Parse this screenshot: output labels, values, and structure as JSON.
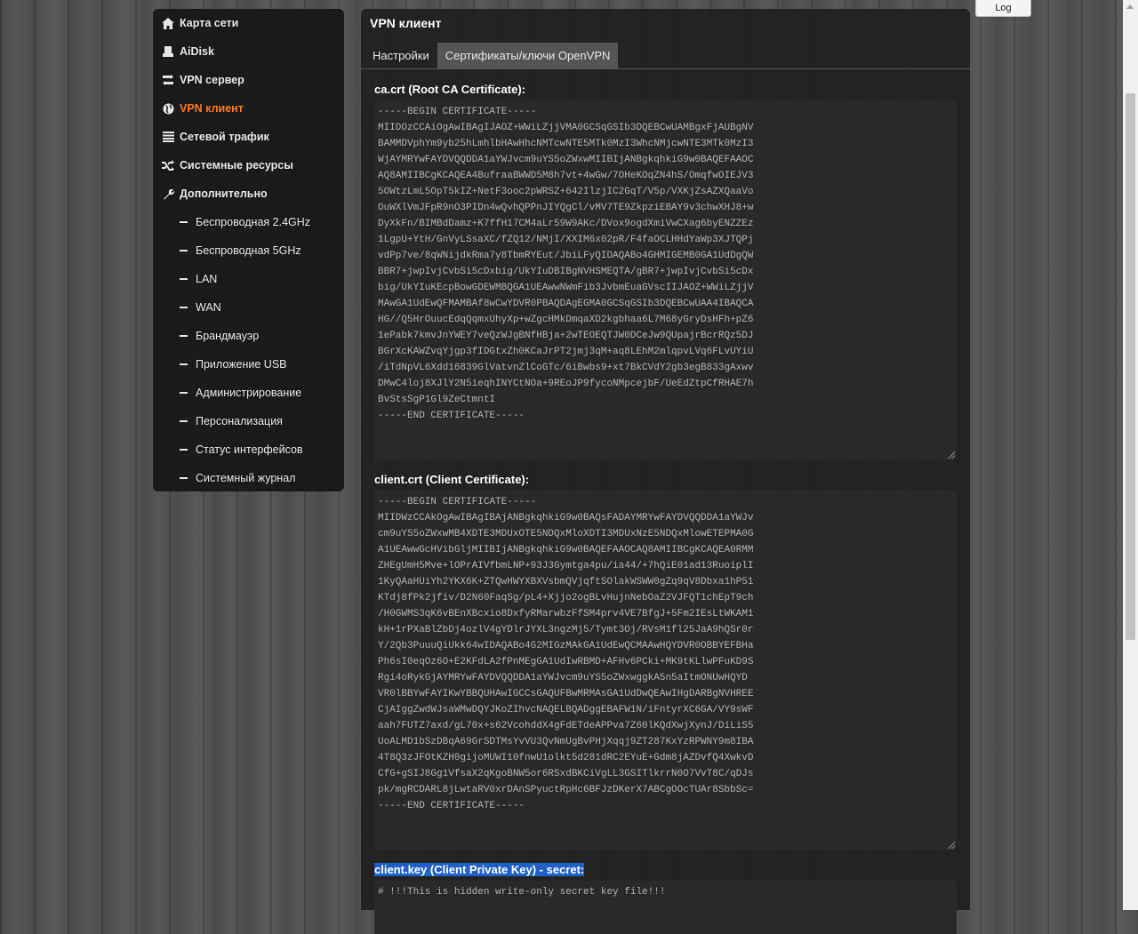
{
  "sidebar": {
    "items": [
      {
        "label": "Карта сети",
        "icon": "home-icon"
      },
      {
        "label": "AiDisk",
        "icon": "disk-icon"
      },
      {
        "label": "VPN сервер",
        "icon": "swap-icon"
      },
      {
        "label": "VPN клиент",
        "icon": "globe-icon",
        "active": true
      },
      {
        "label": "Сетевой трафик",
        "icon": "list-icon"
      },
      {
        "label": "Системные ресурсы",
        "icon": "shuffle-icon"
      },
      {
        "label": "Дополнительно",
        "icon": "wrench-icon"
      }
    ],
    "subitems": [
      "Беспроводная 2.4GHz",
      "Беспроводная 5GHz",
      "LAN",
      "WAN",
      "Брандмауэр",
      "Приложение USB",
      "Администрирование",
      "Персонализация",
      "Статус интерфейсов",
      "Системный журнал"
    ]
  },
  "main": {
    "title": "VPN клиент",
    "tabs": [
      "Настройки",
      "Сертификаты/ключи OpenVPN"
    ],
    "ca_label": "ca.crt (Root CA Certificate):",
    "ca_text": "-----BEGIN CERTIFICATE-----\nMIIDOzCCAiOgAwIBAgIJAOZ+WWiLZjjVMA0GCSqGSIb3DQEBCwUAMBgxFjAUBgNV\nBAMMDVphYm9yb25hLmhlbHAwHhcNMTcwNTE5MTk0MzI3WhcNMjcwNTE3MTk0MzI3\nWjAYMRYwFAYDVQQDDA1aYWJvcm9uYS5oZWxwMIIBIjANBgkqhkiG9w0BAQEFAAOC\nAQ8AMIIBCgKCAQEA4BufraaBWWD5M8h7vt+4wGw/7OHeKOqZN4hS/OmqfwOIEJV3\n5OWtzLmL5OpT5kIZ+NetF3ooc2pWRSZ+642IlzjIC2GqT/V5p/VXKjZsAZXQaaVo\nOuWXlVmJFpR9nO3PIDn4wQvhQPPnJIYQgCl/vMV7TE9ZkpziEBAY9v3chwXHJ8+w\nDyXkFn/BIMBdDamz+K7ffH17CM4aLr59W9AKc/DVox9ogdXmiVwCXag6byENZZEz\n1LgpU+YtH/GnVyLSsaXC/fZQ12/NMjI/XXIM6x02pR/F4faOCLHHdYaWp3XJTQPj\nvdPp7ve/8qWNijdkRma7y8TbmRYEut/JbiLFyQIDAQABo4GHMIGEMB0GA1UdDgQW\nBBR7+jwpIvjCvbSi5cDxbig/UkYIuDBIBgNVHSMEQTA/gBR7+jwpIvjCvbSi5cDx\nbig/UkYIuKEcpBowGDEWMBQGA1UEAwwNWmFib3JvbmEuaGVscIIJAOZ+WWiLZjjV\nMAwGA1UdEwQFMAMBAf8wCwYDVR0PBAQDAgEGMA0GCSqGSIb3DQEBCwUAA4IBAQCA\nHG//Q5HrOuucEdqQqmxUhyXp+wZgcHMkDmqaXD2kgbhaa6L7M68yGryDsHFh+pZ6\n1ePabk7kmvJnYWEY7veQzWJgBNfHBja+2wTEOEQTJW0DCeJw9QUpajrBcrRQz5DJ\nBGrXcKAWZvqYjgp3fIDGtxZh0KCaJrPT2jmj3qM+aq8LEhM2mlqpvLVq6FLvUYiU\n/iTdNpVL6Xdd16839GlVatvnZlCoGTc/6iBwbs9+xt7BkCVdY2gb3egB833gAxwv\nDMwC4loj8XJlY2N5ieqhINYCtNOa+9REoJP9fycoNMpcejbF/UeEdZtpCfRHAE7h\nBvStsSgP1Gl9ZeCtmntI\n-----END CERTIFICATE-----",
    "client_label": "client.crt (Client Certificate):",
    "client_text": "-----BEGIN CERTIFICATE-----\nMIIDWzCCAkOgAwIBAgIBAjANBgkqhkiG9w0BAQsFADAYMRYwFAYDVQQDDA1aYWJv\ncm9uYS5oZWxwMB4XDTE3MDUxOTE5NDQxMloXDTI3MDUxNzE5NDQxMlowETEPMA0G\nA1UEAwwGcHVibGljMIIBIjANBgkqhkiG9w0BAQEFAAOCAQ8AMIIBCgKCAQEA0RMM\nZHEgUmH5Mve+lOPrAIVfbmLNP+93J3Gymtga4pu/ia44/+7hQiE01ad13RuoiplI\n1KyQAaHUiYh2YKX6K+ZTQwHWYXBXVsbmQVjqftSOlakWSWW0gZq9qV8Dbxa1hP51\nKTdj8fPk2jfiv/D2N60FaqSg/pL4+Xjjo2ogBLvHujnNebOaZ2VJFQT1chEpT9ch\n/H0GWMS3qK6vBEnXBcxio8DxfyRMarwbzFfSM4prv4VE7BfgJ+5Fm2IEsLtWKAM1\nkH+1rPXaBlZbDj4ozlV4gYDlrJYXL3ngzMj5/Tymt3Oj/RVsM1fl25JaA9hQSr0r\nY/2Qb3PuuuQiUkk64wIDAQABo4G2MIGzMAkGA1UdEwQCMAAwHQYDVR0OBBYEFBHa\nPh6sI0eqOz6O+E2KFdLA2fPnMEgGA1UdIwRBMD+AFHv6PCki+MK9tKLlwPFuKD9S\nRgi4oRykGjAYMRYwFAYDVQQDDA1aYWJvcm9uYS5oZWxwggkA5n5aItmONUwHQYD\nVR0lBBYwFAYIKwYBBQUHAwIGCCsGAQUFBwMRMAsGA1UdDwQEAwIHgDARBgNVHREE\nCjAIggZwdWJsaWMwDQYJKoZIhvcNAQELBQADggEBAFW1N/iFntyrXC6GA/VY9sWF\naah7FUTZ7axd/gL70x+s62VcohddX4gFdETdeAPPva7Z60lKQdXwjXynJ/DiLiS5\nUoALMD1bSzDBqA69GrSDTMsYvVU3QvNmUgBvPHjXqqj9ZT287KxYzRPWNY9m8IBA\n4T8Q3zJFOtKZH0gijoMUWI10fnwU1olkt5d281dRC2EYuE+Gdm8jAZDvfQ4XwkvD\nCfG+gSIJ8Gg1VfsaX2qKgoBNW5or6RSxdBKCiVgLL3GSITlkrrN0O7VvT8C/qDJs\npk/mgRCDARL8jLwtaRV0xrDAnSPyuctRpHc6BFJzDKerX7ABCgOOcTUAr8SbbSc=\n-----END CERTIFICATE-----",
    "key_label": "client.key (Client Private Key) - secret:",
    "key_text": "# !!!This is hidden write-only secret key file!!!"
  },
  "top": {
    "log_label": "Log"
  }
}
